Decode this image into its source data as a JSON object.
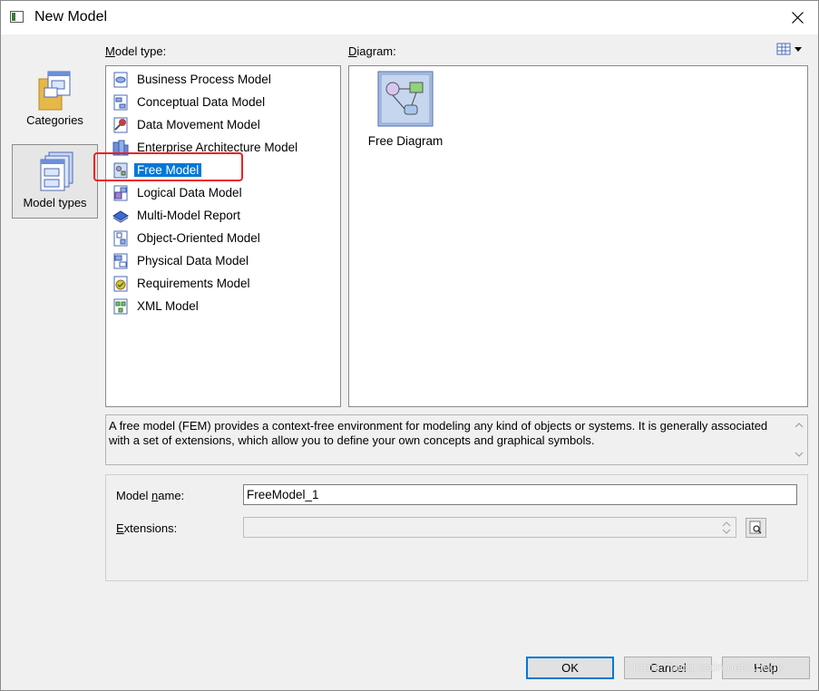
{
  "window": {
    "title": "New Model",
    "close_icon": "close-icon"
  },
  "sidebar": {
    "items": [
      {
        "label": "Categories",
        "icon": "categories-icon",
        "selected": false
      },
      {
        "label": "Model types",
        "icon": "model-types-icon",
        "selected": true
      }
    ]
  },
  "model_type": {
    "label_underline": "M",
    "label_rest": "odel type:",
    "items": [
      {
        "label": "Business Process Model",
        "icon": "business-process-model-icon"
      },
      {
        "label": "Conceptual Data Model",
        "icon": "conceptual-data-model-icon"
      },
      {
        "label": "Data Movement Model",
        "icon": "data-movement-model-icon"
      },
      {
        "label": "Enterprise Architecture Model",
        "icon": "enterprise-architecture-model-icon"
      },
      {
        "label": "Free Model",
        "icon": "free-model-icon",
        "selected": true
      },
      {
        "label": "Logical Data Model",
        "icon": "logical-data-model-icon"
      },
      {
        "label": "Multi-Model Report",
        "icon": "multi-model-report-icon"
      },
      {
        "label": "Object-Oriented Model",
        "icon": "object-oriented-model-icon"
      },
      {
        "label": "Physical Data Model",
        "icon": "physical-data-model-icon"
      },
      {
        "label": "Requirements Model",
        "icon": "requirements-model-icon"
      },
      {
        "label": "XML Model",
        "icon": "xml-model-icon"
      }
    ]
  },
  "diagram": {
    "label_underline": "D",
    "label_rest": "iagram:",
    "items": [
      {
        "label": "Free Diagram",
        "icon": "free-diagram-icon",
        "selected": true
      }
    ]
  },
  "view_button": {
    "icon": "list-view-icon"
  },
  "description": "A free model (FEM) provides a context-free environment for modeling any kind of objects or systems. It is generally associated with a set of extensions, which allow you to define your own concepts and graphical symbols.",
  "form": {
    "model_name_label_a": "Model ",
    "model_name_label_u": "n",
    "model_name_label_b": "ame:",
    "model_name_value": "FreeModel_1",
    "extensions_label_u": "E",
    "extensions_label_rest": "xtensions:",
    "extensions_value": ""
  },
  "buttons": {
    "ok": "OK",
    "cancel": "Cancel",
    "help": "Help"
  },
  "watermark": "https://blog.csdn.net/Apeop",
  "colors": {
    "selection": "#0078d7",
    "highlight": "#f02020"
  }
}
